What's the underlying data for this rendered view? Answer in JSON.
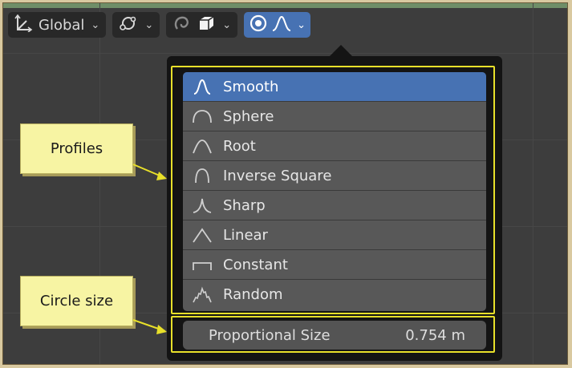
{
  "toolbar": {
    "orientation_label": "Global"
  },
  "profiles": {
    "items": [
      {
        "label": "Smooth",
        "icon": "smooth-curve-icon",
        "active": true
      },
      {
        "label": "Sphere",
        "icon": "sphere-curve-icon",
        "active": false
      },
      {
        "label": "Root",
        "icon": "root-curve-icon",
        "active": false
      },
      {
        "label": "Inverse Square",
        "icon": "inverse-square-curve-icon",
        "active": false
      },
      {
        "label": "Sharp",
        "icon": "sharp-curve-icon",
        "active": false
      },
      {
        "label": "Linear",
        "icon": "linear-curve-icon",
        "active": false
      },
      {
        "label": "Constant",
        "icon": "constant-curve-icon",
        "active": false
      },
      {
        "label": "Random",
        "icon": "random-curve-icon",
        "active": false
      }
    ]
  },
  "size_field": {
    "label": "Proportional Size",
    "value": "0.754 m"
  },
  "callouts": {
    "profiles": "Profiles",
    "circle_size": "Circle size"
  },
  "colors": {
    "accent": "#4772b3",
    "highlight": "#e8e02a",
    "callout_bg": "#f7f4a3",
    "viewport_bg": "#3d3d3d"
  }
}
